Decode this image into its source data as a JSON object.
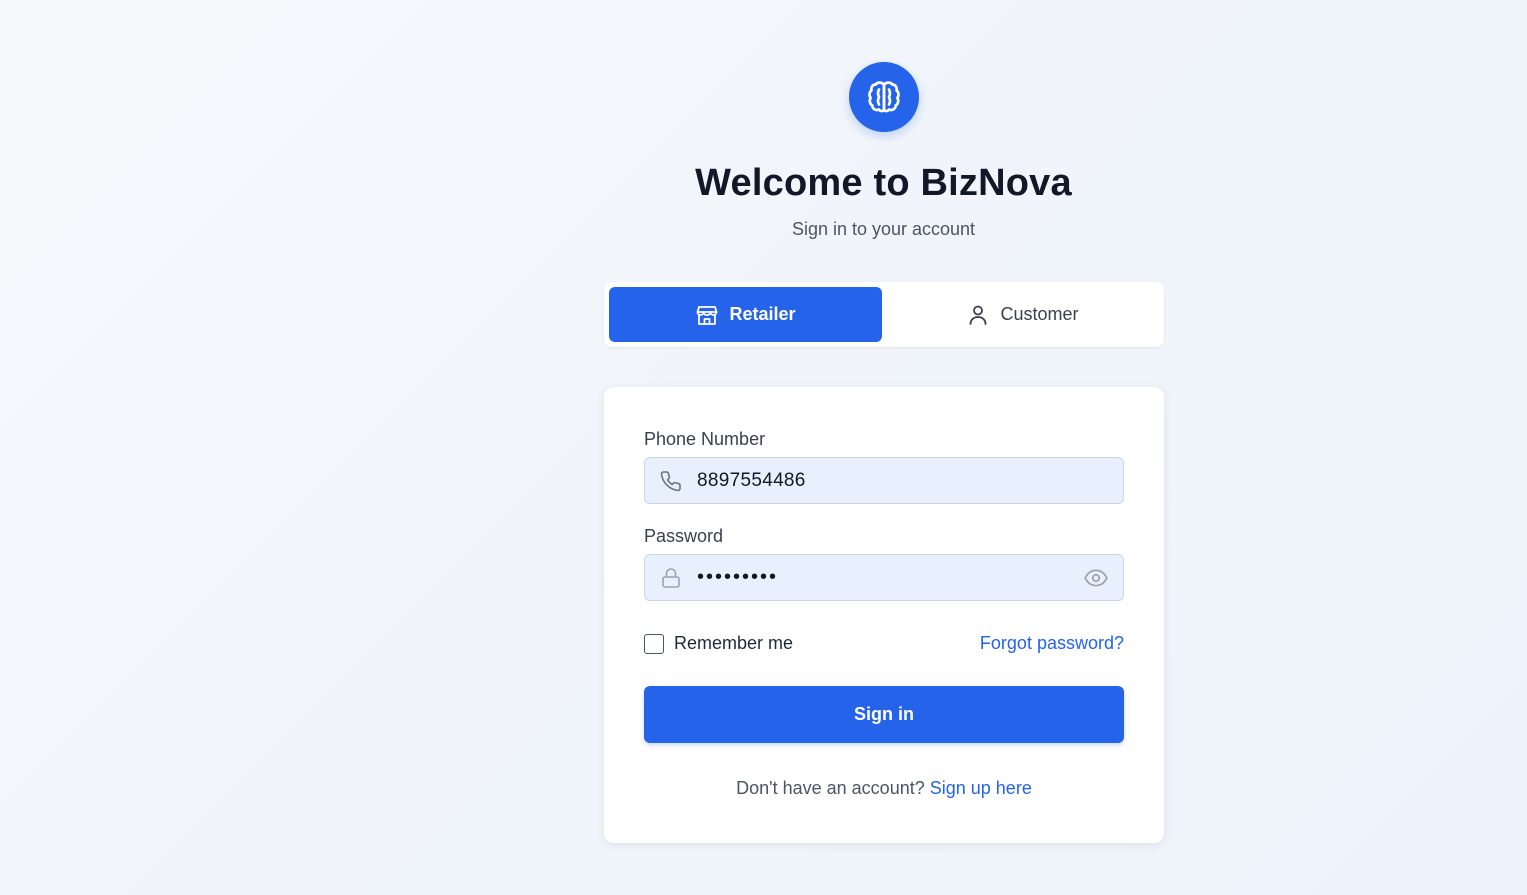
{
  "brand": {
    "logo_icon": "brain-icon",
    "title": "Welcome to BizNova",
    "subtitle": "Sign in to your account"
  },
  "role_toggle": {
    "selected": "Retailer",
    "options": [
      {
        "label": "Retailer",
        "icon": "store-icon"
      },
      {
        "label": "Customer",
        "icon": "user-icon"
      }
    ]
  },
  "form": {
    "phone": {
      "label": "Phone Number",
      "value": "8897554486",
      "icon": "phone-icon"
    },
    "password": {
      "label": "Password",
      "value": "•••••••••",
      "icon": "lock-icon",
      "toggle_icon": "eye-icon"
    },
    "remember_label": "Remember me",
    "remember_checked": false,
    "forgot_label": "Forgot password?",
    "submit_label": "Sign in",
    "signup_prompt": "Don't have an account?",
    "signup_link": "Sign up here"
  },
  "colors": {
    "accent": "#2563eb",
    "input_bg": "#e8f0fe",
    "text_dark": "#111827",
    "text_muted": "#4b5563"
  }
}
